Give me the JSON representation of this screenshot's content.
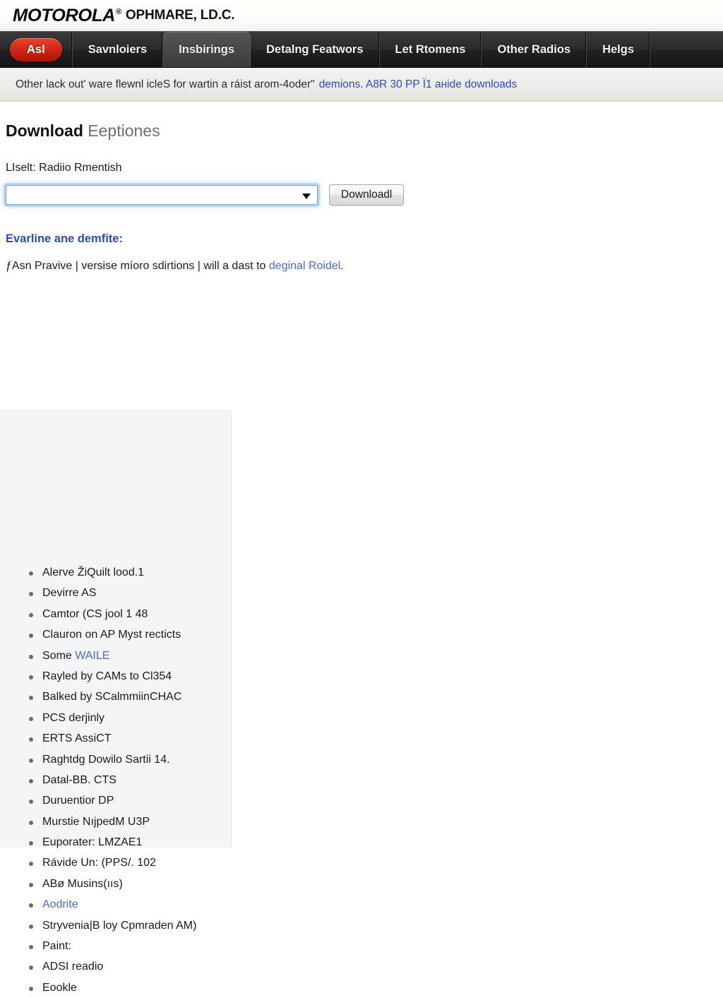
{
  "brand": {
    "logo": "MOTOROLA",
    "registered": "®",
    "subtitle": "OPHMARE, LD.C."
  },
  "nav": {
    "pill": "Asl",
    "items": [
      {
        "label": "Savnloiers",
        "active": false
      },
      {
        "label": "Insbirings",
        "active": true
      },
      {
        "label": "Detalng Featwors",
        "active": false
      },
      {
        "label": "Let Rtomens",
        "active": false
      },
      {
        "label": "Other Radios",
        "active": false
      },
      {
        "label": "Helgs",
        "active": false
      }
    ]
  },
  "notice": {
    "text": "Other lack out' ware flewnl icleS for wartin a ráist arom-4oderʺ",
    "link": "demions. A8R 30 PP Ï1 aнide downloads"
  },
  "main": {
    "title_strong": "Download",
    "title_rest": "Eeptiones",
    "field_label": "LIselt: Radiio Rmentish",
    "select_value": "",
    "select_placeholder": "",
    "download_button": "Downloadl",
    "blue_heading": "Evarline ane demfite:",
    "desc_prefix": "ƒAsn Pravive | versise míoro sdirtions | will a dast to ",
    "desc_link": "deginal Roidel",
    "desc_suffix": "."
  },
  "list": {
    "items": [
      {
        "text": "Alerve ŽiQuilt lood.1",
        "link": false
      },
      {
        "text": "Devirre AS",
        "link": false
      },
      {
        "text": "Camtor (CS jool 1 48",
        "link": false
      },
      {
        "text": "Clauron on AP Myst recticts",
        "link": false
      },
      {
        "text": "Some ",
        "link": false,
        "link_tail": "WAILE"
      },
      {
        "text": "Rayled by CAMs to Cl354",
        "link": false
      },
      {
        "text": "Balked by SCalmmiinCHAC",
        "link": false
      },
      {
        "text": "PCS derjinly",
        "link": false
      },
      {
        "text": "ERTS AssiCT",
        "link": false
      },
      {
        "text": "Raghtdg Dowilo Sartii 14.",
        "link": false
      },
      {
        "text": "Datal-BB. CTS",
        "link": false
      },
      {
        "text": "Duruentior DP",
        "link": false
      },
      {
        "text": "Murstie NıјpedM U3P",
        "link": false
      },
      {
        "text": "Euporater: LMZAE1",
        "link": false
      },
      {
        "text": "Rávide Un: (PPS/. 102",
        "link": false
      },
      {
        "text": "ABø Musins(ııs)",
        "link": false
      },
      {
        "text": "Aodrite",
        "link": true
      },
      {
        "text": "Stryvenia|B loy Cpmraden AM)",
        "link": false
      },
      {
        "text": "Paint:",
        "link": false
      },
      {
        "text": "ADSI readio",
        "link": false
      },
      {
        "text": "Eookle",
        "link": false
      }
    ]
  },
  "colors": {
    "accent_red": "#d12a16",
    "link_blue": "#2b49c6",
    "list_link_blue": "#4a6ad0",
    "nav_dark": "#2b2b2b",
    "panel_gray": "#f4f5f7"
  }
}
